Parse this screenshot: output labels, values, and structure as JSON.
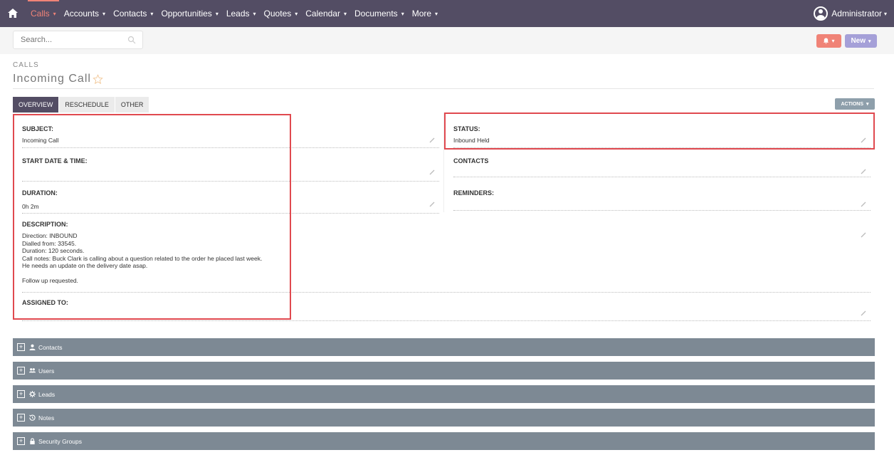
{
  "nav": {
    "items": [
      {
        "label": "Calls",
        "active": true
      },
      {
        "label": "Accounts"
      },
      {
        "label": "Contacts"
      },
      {
        "label": "Opportunities"
      },
      {
        "label": "Leads"
      },
      {
        "label": "Quotes"
      },
      {
        "label": "Calendar"
      },
      {
        "label": "Documents"
      },
      {
        "label": "More"
      }
    ],
    "user": "Administrator",
    "caret": "▾"
  },
  "search": {
    "placeholder": "Search..."
  },
  "header_buttons": {
    "new_label": "New",
    "caret": "▾"
  },
  "module": {
    "label": "CALLS",
    "title": "Incoming Call"
  },
  "tabs": [
    "OVERVIEW",
    "RESCHEDULE",
    "OTHER"
  ],
  "actions": {
    "label": "ACTIONS",
    "caret": "▾"
  },
  "fields": {
    "subject": {
      "label": "SUBJECT:",
      "value": "Incoming Call"
    },
    "start_date": {
      "label": "START DATE & TIME:",
      "value": ""
    },
    "duration": {
      "label": "DURATION:",
      "value": "0h 2m"
    },
    "description": {
      "label": "DESCRIPTION:",
      "value": "Direction: INBOUND\nDialled from: 33545.\nDuration: 120 seconds.\nCall notes: Buck Clark is calling about a question related to the order he placed last week.\nHe needs an update on the delivery date asap.\n\nFollow up requested."
    },
    "assigned_to": {
      "label": "ASSIGNED TO:",
      "value": ""
    },
    "status": {
      "label": "STATUS:",
      "value": "Inbound Held"
    },
    "contacts": {
      "label": "CONTACTS",
      "value": ""
    },
    "reminders": {
      "label": "REMINDERS:",
      "value": ""
    }
  },
  "subpanels": [
    {
      "label": "Contacts",
      "icon": "person-icon"
    },
    {
      "label": "Users",
      "icon": "users-icon"
    },
    {
      "label": "Leads",
      "icon": "gear-icon"
    },
    {
      "label": "Notes",
      "icon": "history-icon"
    },
    {
      "label": "Security Groups",
      "icon": "lock-icon"
    }
  ],
  "colors": {
    "nav_bg": "#534d64",
    "accent": "#f08377",
    "new_button": "#a5a0d8",
    "subpanel": "#7d8994",
    "highlight": "#e0494f"
  }
}
